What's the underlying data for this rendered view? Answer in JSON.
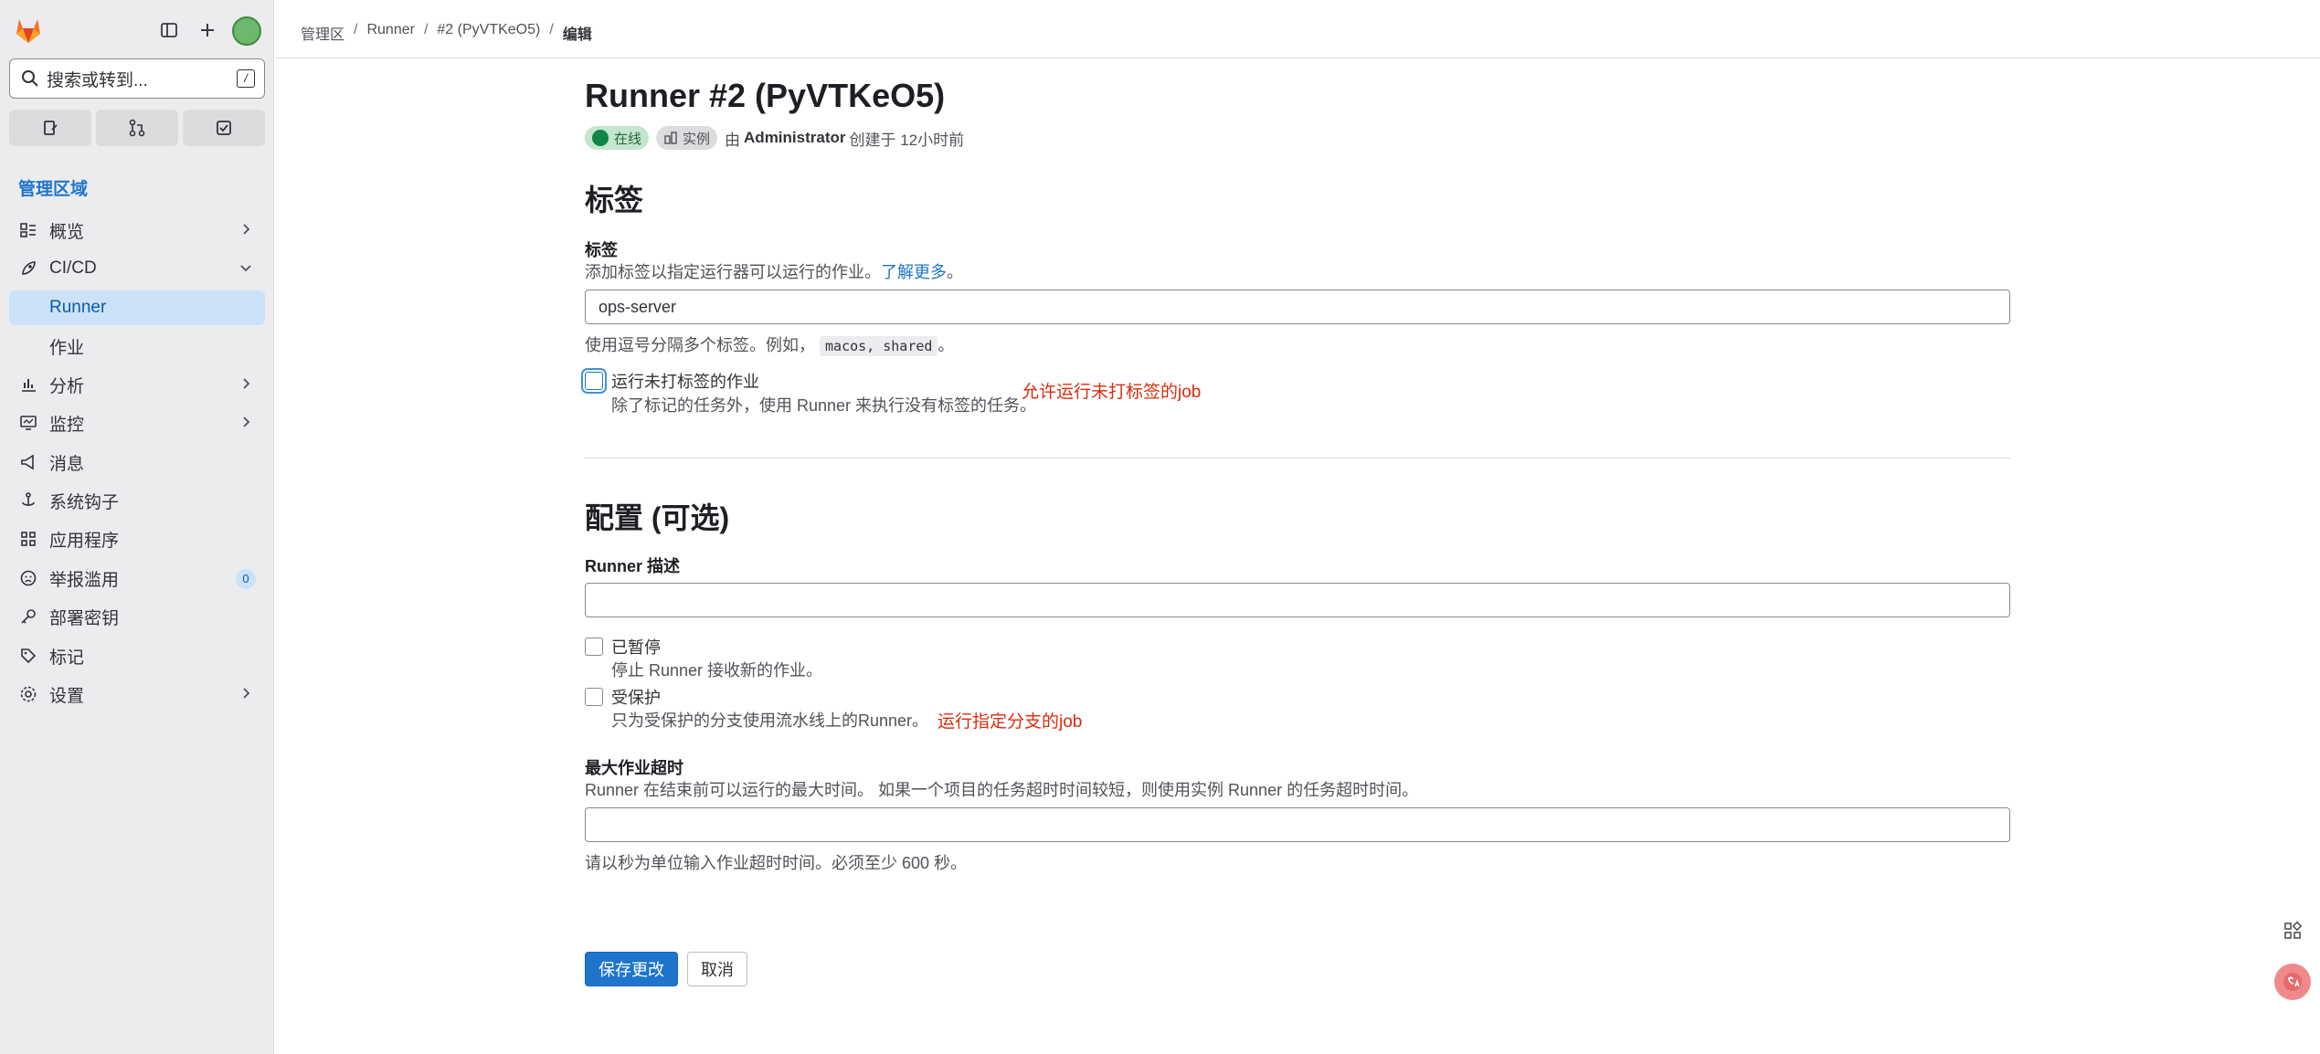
{
  "sidebar": {
    "search_placeholder": "搜索或转到...",
    "search_shortcut": "/",
    "section_title": "管理区域",
    "items": [
      {
        "label": "概览",
        "icon": "overview-icon"
      },
      {
        "label": "CI/CD",
        "icon": "rocket-icon"
      },
      {
        "label": "Runner"
      },
      {
        "label": "作业"
      },
      {
        "label": "分析",
        "icon": "chart-icon"
      },
      {
        "label": "监控",
        "icon": "monitor-icon"
      },
      {
        "label": "消息",
        "icon": "megaphone-icon"
      },
      {
        "label": "系统钩子",
        "icon": "hook-icon"
      },
      {
        "label": "应用程序",
        "icon": "apps-icon"
      },
      {
        "label": "举报滥用",
        "icon": "abuse-icon",
        "badge": "0"
      },
      {
        "label": "部署密钥",
        "icon": "key-icon"
      },
      {
        "label": "标记",
        "icon": "label-icon"
      },
      {
        "label": "设置",
        "icon": "settings-icon"
      }
    ]
  },
  "breadcrumb": [
    "管理区",
    "Runner",
    "#2 (PyVTKeO5)",
    "编辑"
  ],
  "page": {
    "title": "Runner #2 (PyVTKeO5)",
    "status_online": "在线",
    "status_instance": "实例",
    "created_prefix": "由",
    "created_by": "Administrator",
    "created_suffix": "创建于 12小时前"
  },
  "tags_section": {
    "heading": "标签",
    "label": "标签",
    "help": "添加标签以指定运行器可以运行的作业。",
    "learn_more": "了解更多",
    "learn_more_suffix": "。",
    "value": "ops-server",
    "hint_prefix": "使用逗号分隔多个标签。例如，",
    "hint_code": "macos, shared",
    "hint_suffix": "。",
    "untagged_label": "运行未打标签的作业",
    "untagged_help": "除了标记的任务外，使用 Runner 来执行没有标签的任务。",
    "untagged_annotation": "允许运行未打标签的job"
  },
  "config_section": {
    "heading": "配置 (可选)",
    "desc_label": "Runner 描述",
    "desc_value": "",
    "paused_label": "已暂停",
    "paused_help": "停止 Runner 接收新的作业。",
    "protected_label": "受保护",
    "protected_help": "只为受保护的分支使用流水线上的Runner。",
    "protected_annotation": "运行指定分支的job",
    "timeout_label": "最大作业超时",
    "timeout_help": "Runner 在结束前可以运行的最大时间。 如果一个项目的任务超时时间较短，则使用实例 Runner 的任务超时时间。",
    "timeout_value": "",
    "timeout_hint": "请以秒为单位输入作业超时时间。必须至少 600 秒。"
  },
  "actions": {
    "save": "保存更改",
    "cancel": "取消"
  },
  "colors": {
    "accent": "#1f75cb",
    "annotation": "#dd2b0e",
    "online": "#108548"
  }
}
